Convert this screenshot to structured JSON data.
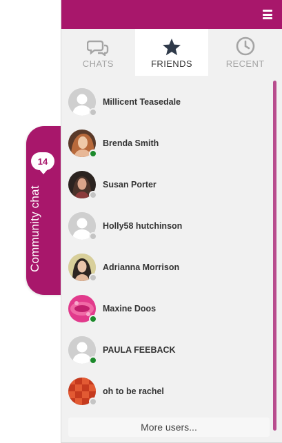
{
  "side_tab": {
    "label": "Community chat",
    "badge_count": "14",
    "color": "#a8176b"
  },
  "header": {
    "menu_icon": "hamburger-menu-icon",
    "color": "#a8176b"
  },
  "tabs": [
    {
      "label": "CHATS",
      "icon": "chat-bubbles-icon",
      "active": false
    },
    {
      "label": "FRIENDS",
      "icon": "star-icon",
      "active": true
    },
    {
      "label": "RECENT",
      "icon": "clock-icon",
      "active": false
    }
  ],
  "users": [
    {
      "name": "Millicent Teasedale",
      "avatar": "default-avatar",
      "status": "offline"
    },
    {
      "name": "Brenda Smith",
      "avatar": "photo-avatar",
      "status": "online"
    },
    {
      "name": "Susan Porter",
      "avatar": "photo-avatar",
      "status": "offline"
    },
    {
      "name": "Holly58 hutchinson",
      "avatar": "default-avatar",
      "status": "offline"
    },
    {
      "name": "Adrianna Morrison",
      "avatar": "photo-avatar",
      "status": "offline"
    },
    {
      "name": "Maxine Doos",
      "avatar": "photo-avatar",
      "status": "online"
    },
    {
      "name": "PAULA FEEBACK",
      "avatar": "default-avatar",
      "status": "online"
    },
    {
      "name": "oh to be rachel",
      "avatar": "checker-avatar",
      "status": "offline"
    }
  ],
  "more_users": "More users...",
  "status_colors": {
    "online": "#1c8a2b",
    "offline": "#c4c4c4"
  }
}
